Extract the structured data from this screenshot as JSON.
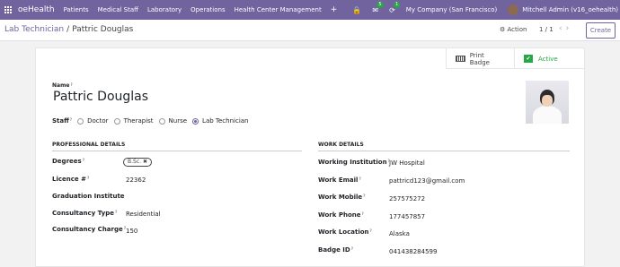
{
  "nav": {
    "brand": "oeHealth",
    "menu": [
      "Patients",
      "Medical Staff",
      "Laboratory",
      "Operations",
      "Health Center Management",
      "+"
    ],
    "chat_badge": "5",
    "activity_badge": "1",
    "company": "My Company (San Francisco)",
    "user": "Mitchell Admin (v16_oehealth)"
  },
  "control": {
    "breadcrumb_parent": "Lab Technician",
    "breadcrumb_sep": "/",
    "breadcrumb_current": "Pattric Douglas",
    "action": "Action",
    "pager": "1 / 1",
    "create": "Create"
  },
  "buttons": {
    "print_badge": "Print Badge",
    "active": "Active"
  },
  "form": {
    "name_label": "Name",
    "name": "Pattric Douglas",
    "staff_label": "Staff",
    "staff_options": [
      "Doctor",
      "Therapist",
      "Nurse",
      "Lab Technician"
    ],
    "staff_selected": "Lab Technician"
  },
  "professional": {
    "title": "PROFESSIONAL DETAILS",
    "degrees_label": "Degrees",
    "degree_tag": "B.Sc.",
    "licence_label": "Licence #",
    "licence": "22362",
    "graduation_label": "Graduation Institute",
    "consultancy_type_label": "Consultancy Type",
    "consultancy_type": "Residential",
    "consultancy_charge_label": "Consultancy Charge",
    "consultancy_charge": "150"
  },
  "work": {
    "title": "WORK DETAILS",
    "institution_label": "Working Institution",
    "institution": "JW Hospital",
    "email_label": "Work Email",
    "email": "pattricd123@gmail.com",
    "mobile_label": "Work Mobile",
    "mobile": "257575272",
    "phone_label": "Work Phone",
    "phone": "177457857",
    "location_label": "Work Location",
    "location": "Alaska",
    "badge_label": "Badge ID",
    "badge": "041438284599"
  },
  "colors": {
    "brand": "#71639e",
    "active": "#28a745"
  }
}
